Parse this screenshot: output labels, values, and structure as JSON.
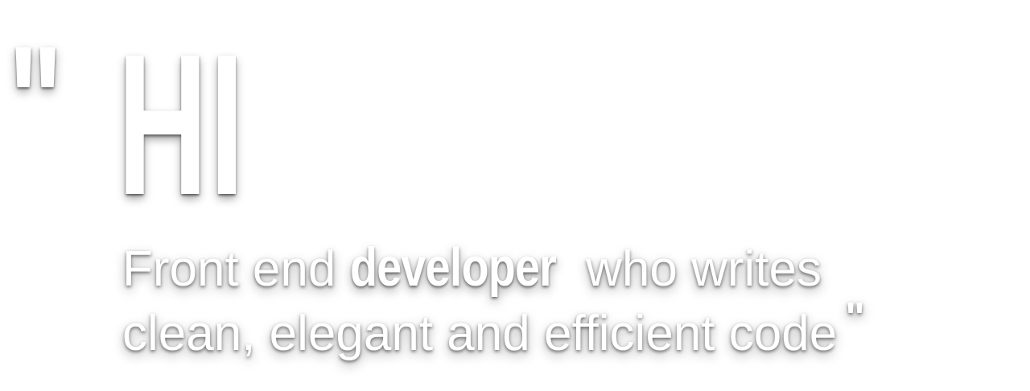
{
  "hero": {
    "open_quote": "\"",
    "greeting": "HI",
    "tagline": {
      "line1_before": "Front end",
      "line1_emphasis": "developer",
      "line1_after": "who writes",
      "line2": "clean, elegant and efficient code",
      "close_quote": "\""
    }
  },
  "colors": {
    "background": "#ffffff",
    "text": "#ffffff",
    "shadow": "#000000"
  }
}
